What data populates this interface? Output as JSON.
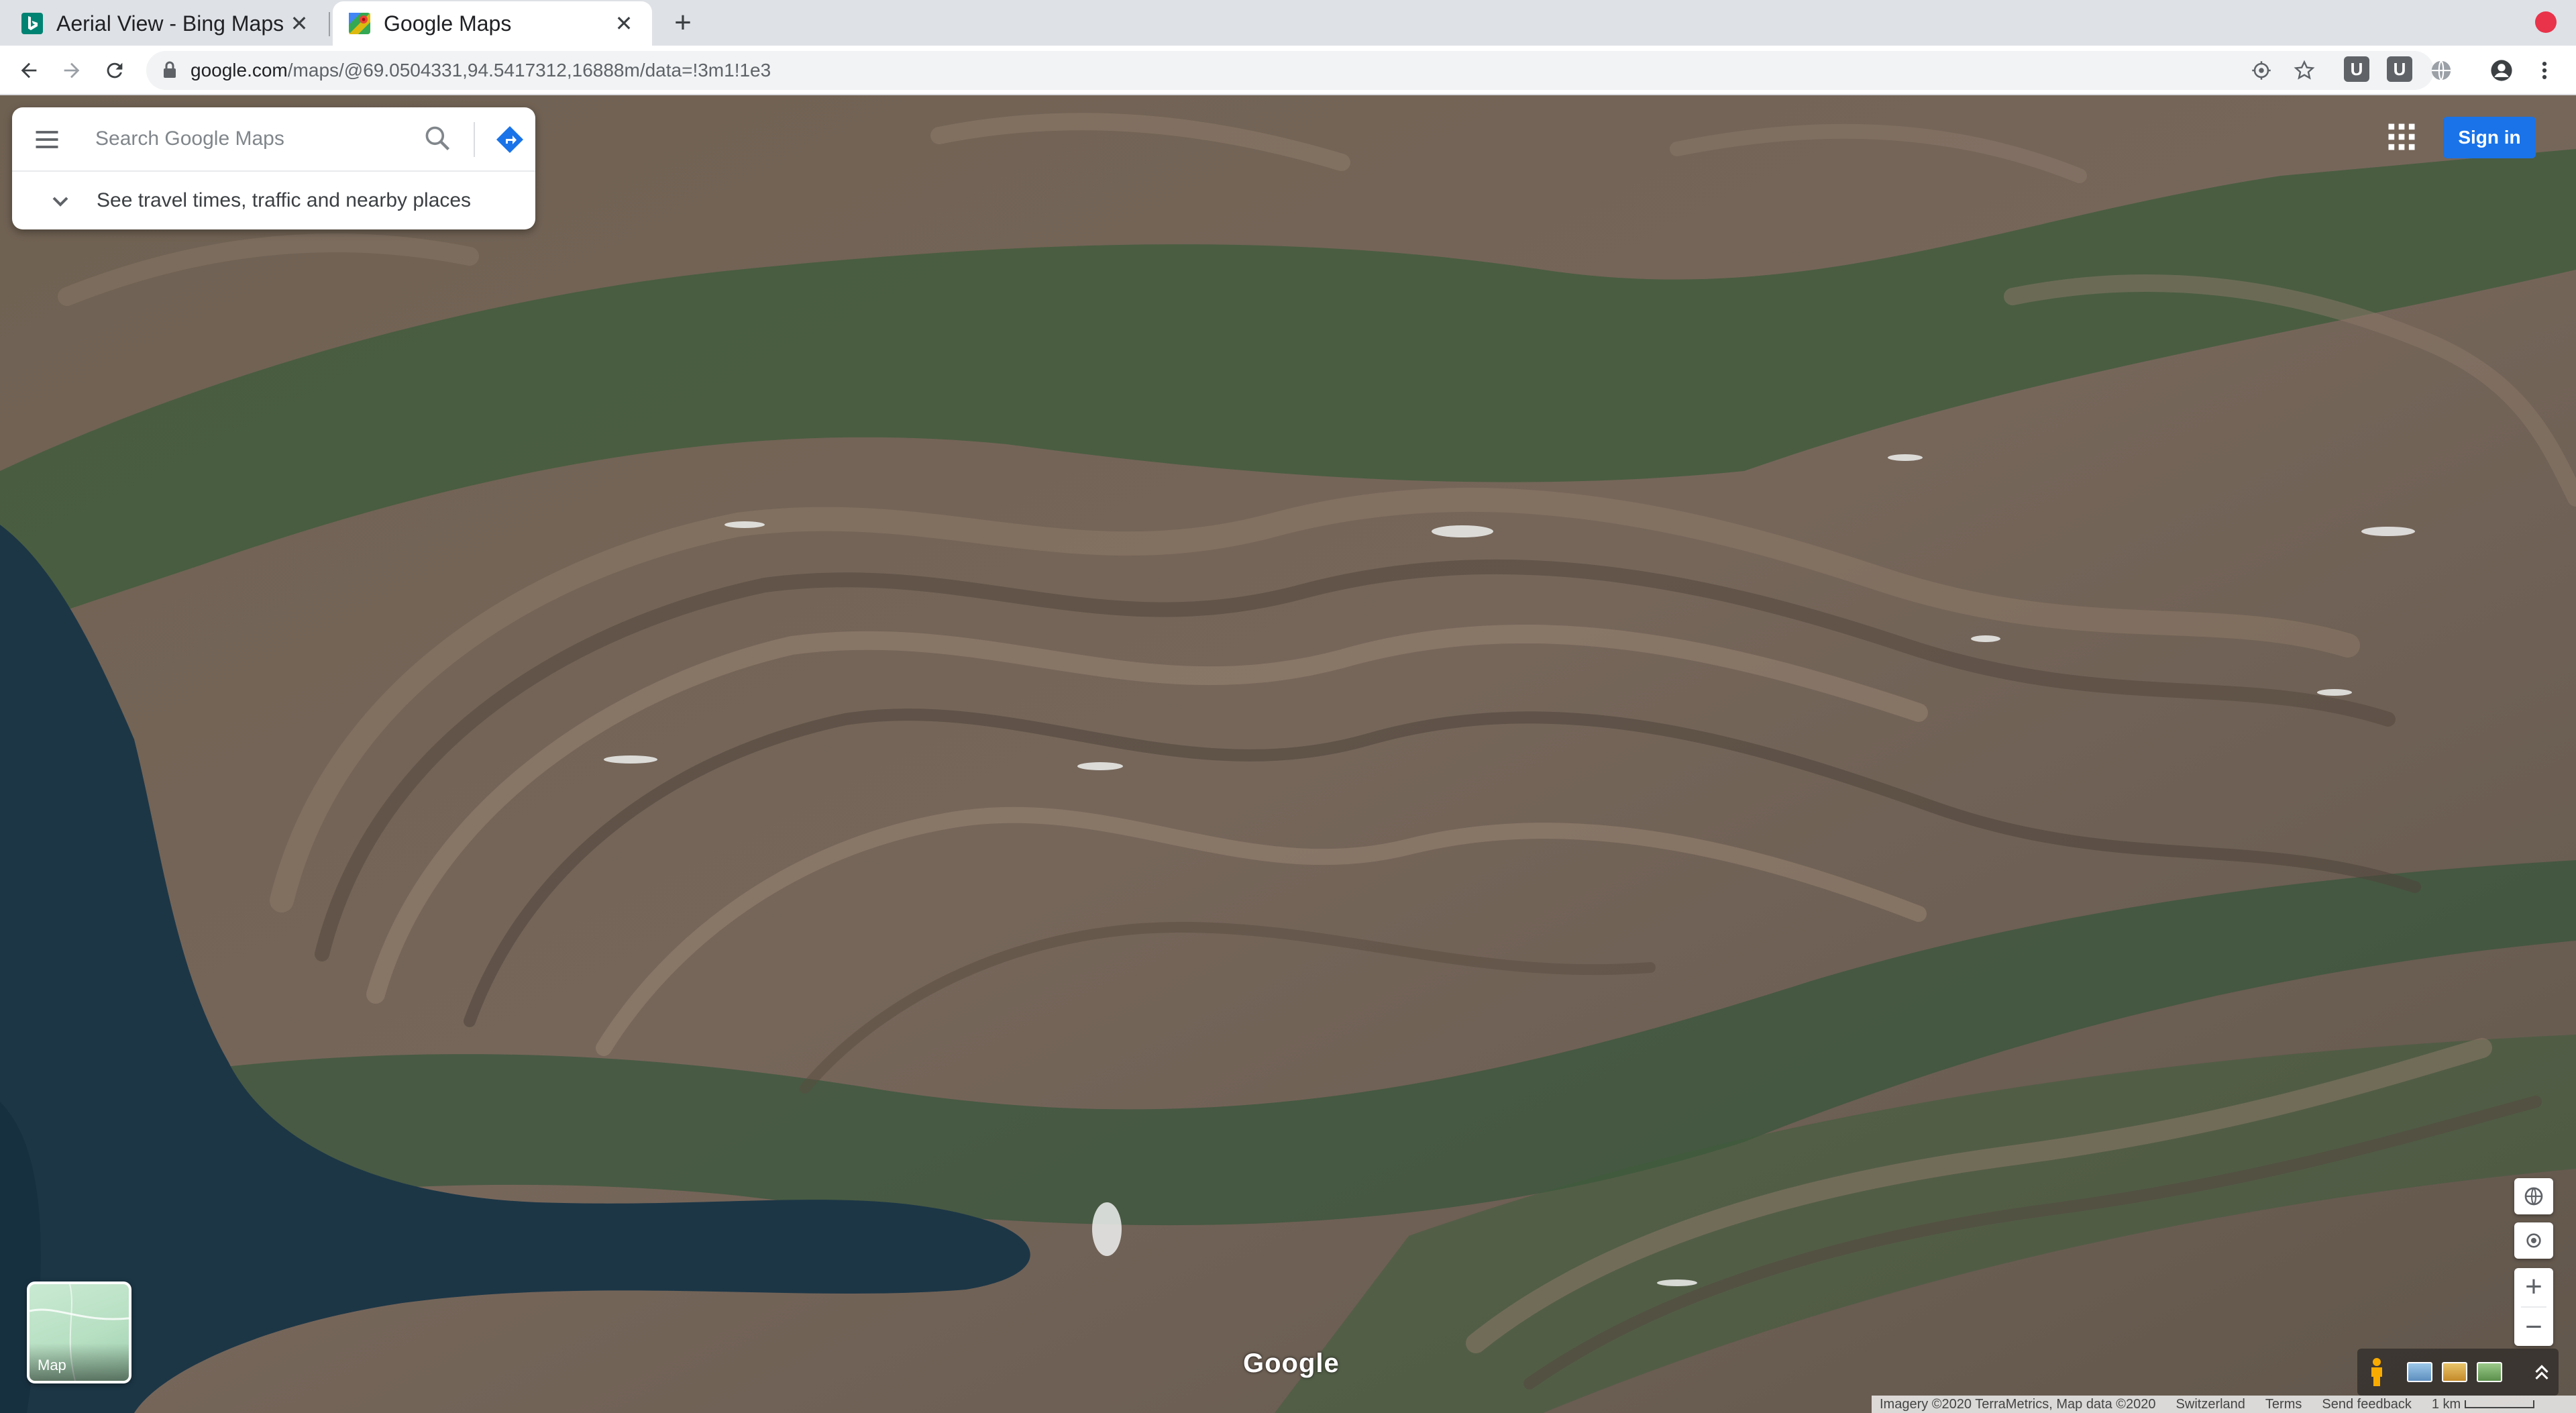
{
  "browser": {
    "tabs": [
      {
        "title": "Aerial View - Bing Maps",
        "active": false,
        "favicon": "bing-icon"
      },
      {
        "title": "Google Maps",
        "active": true,
        "favicon": "google-maps-icon"
      }
    ],
    "close_glyph": "✕",
    "new_tab_glyph": "+",
    "url_host": "google.com",
    "url_path": "/maps/@69.0504331,94.5417312,16888m/data=!3m1!1e3",
    "extensions": [
      "U",
      "U"
    ]
  },
  "map": {
    "search_placeholder": "Search Google Maps",
    "travel_text": "See travel times, traffic and nearby places",
    "sign_in": "Sign in",
    "minimap_label": "Map",
    "logo": "Google",
    "zoom_in": "+",
    "zoom_out": "−",
    "attribution": {
      "imagery": "Imagery ©2020 TerraMetrics, Map data ©2020",
      "region": "Switzerland",
      "terms": "Terms",
      "feedback": "Send feedback",
      "scale": "1 km"
    }
  },
  "colors": {
    "accent": "#1a73e8",
    "terrain_base": "#6e6052",
    "water": "#1c3646",
    "vegetation": "#2f5a34",
    "record_dot": "#e8334a"
  }
}
